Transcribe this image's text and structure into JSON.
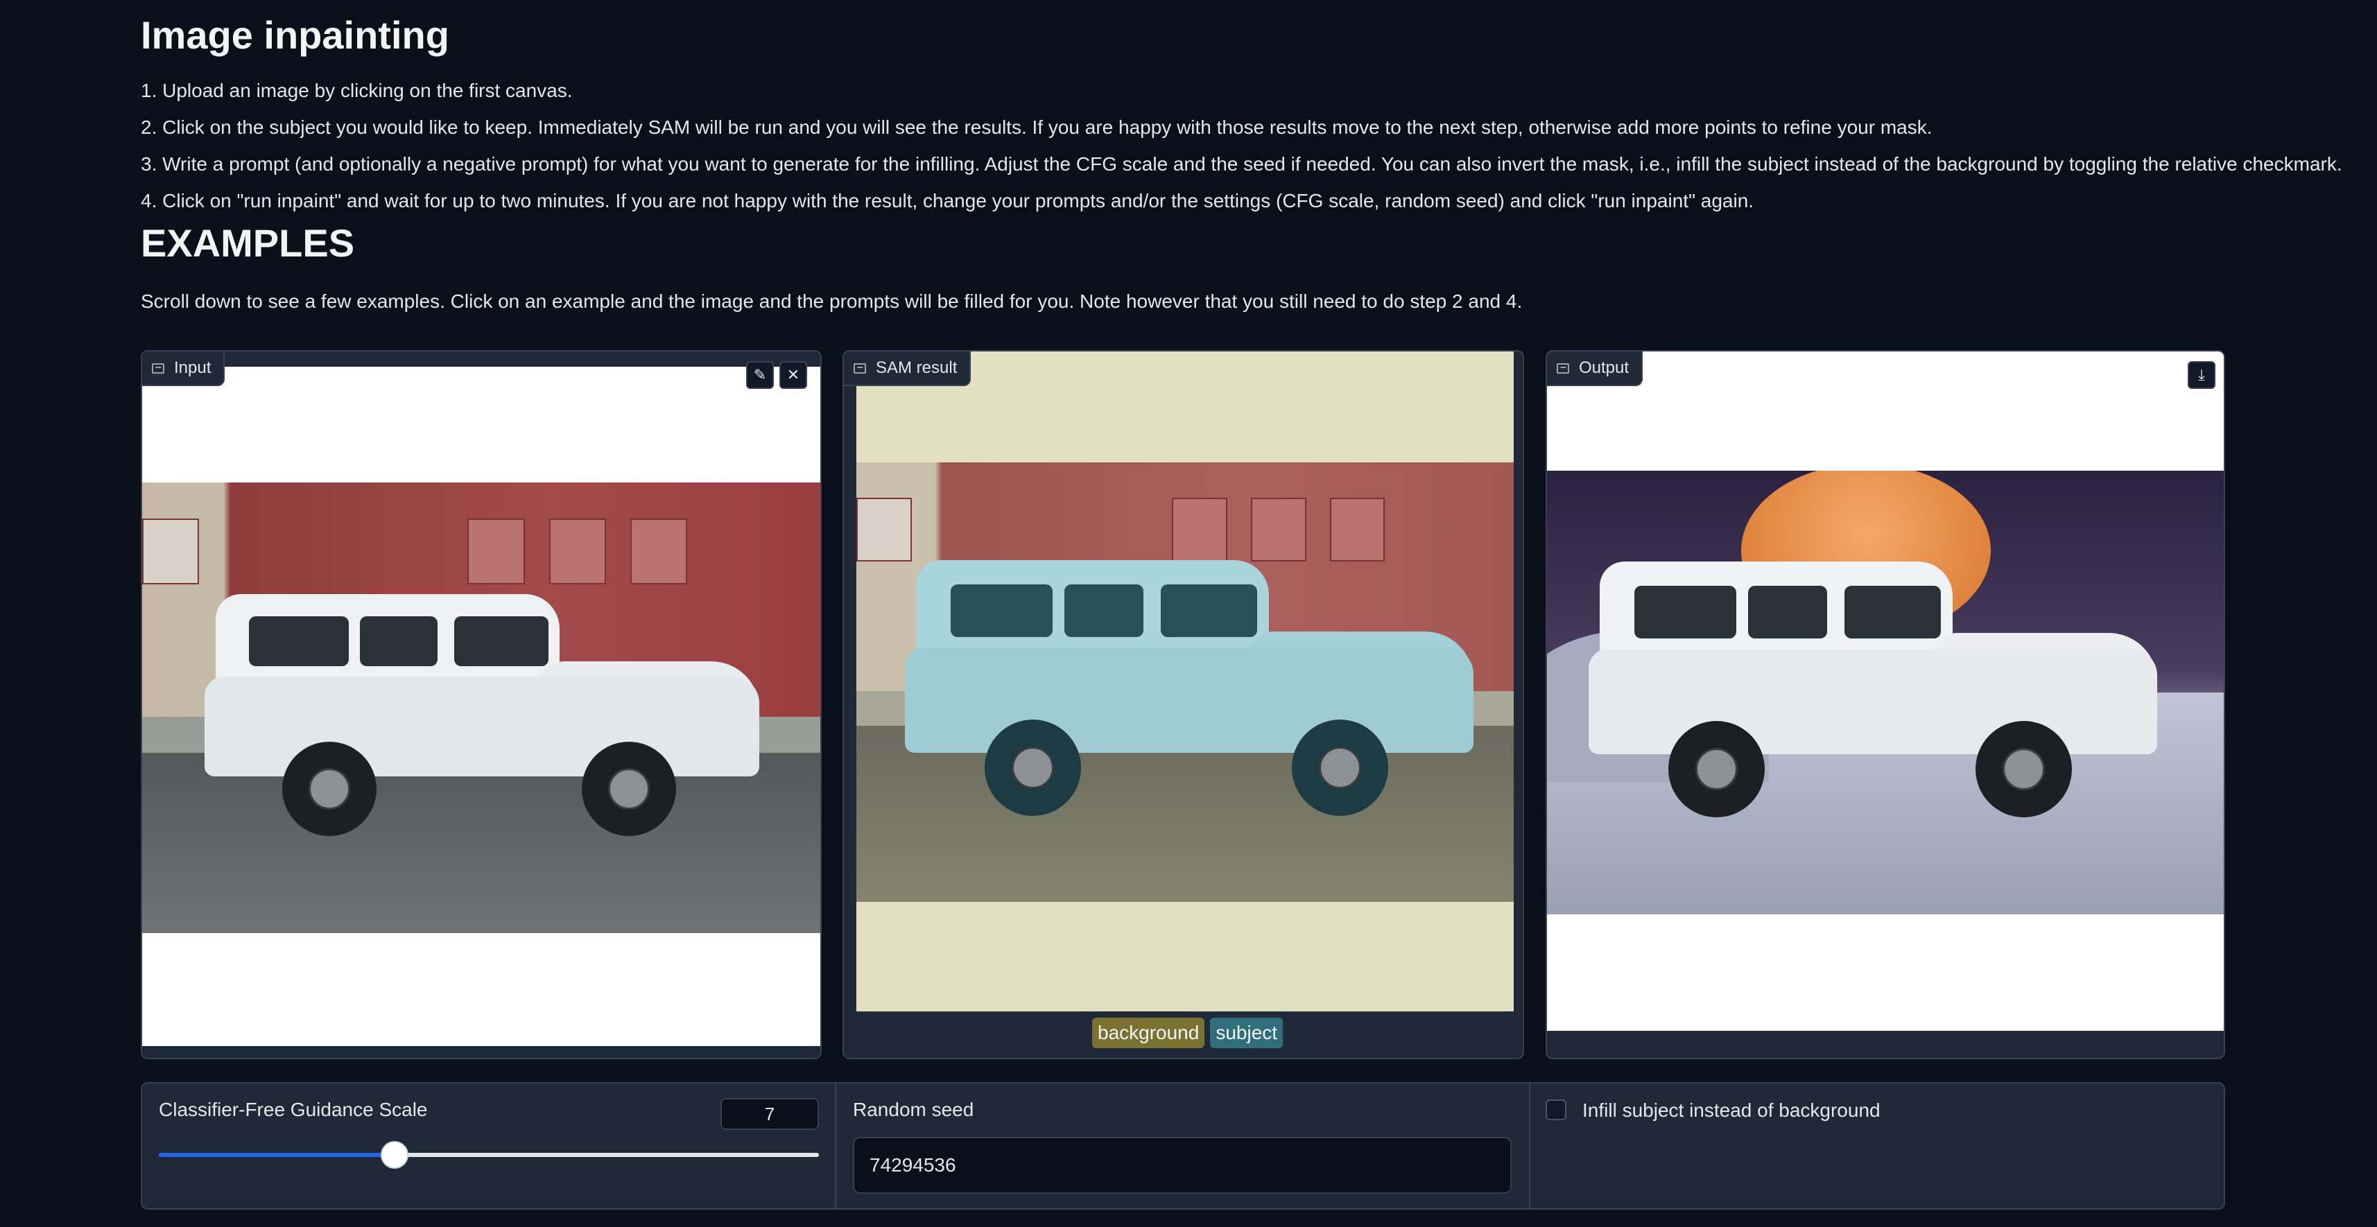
{
  "header": {
    "title": "Image inpainting",
    "steps": [
      "1. Upload an image by clicking on the first canvas.",
      "2. Click on the subject you would like to keep. Immediately SAM will be run and you will see the results. If you are happy with those results move to the next step, otherwise add more points to refine your mask.",
      "3. Write a prompt (and optionally a negative prompt) for what you want to generate for the infilling. Adjust the CFG scale and the seed if needed. You can also invert the mask, i.e., infill the subject instead of the background by toggling the relative checkmark.",
      "4. Click on \"run inpaint\" and wait for up to two minutes. If you are not happy with the result, change your prompts and/or the settings (CFG scale, random seed) and click \"run inpaint\" again."
    ]
  },
  "examples": {
    "heading": "EXAMPLES",
    "note": "Scroll down to see a few examples. Click on an example and the image and the prompts will be filled for you. Note however that you still need to do step 2 and 4."
  },
  "panels": {
    "input": {
      "label": "Input",
      "icon": "image-icon",
      "edit_icon": "pencil-icon",
      "close_icon": "close-icon"
    },
    "sam": {
      "label": "SAM result",
      "icon": "image-icon",
      "legend": [
        {
          "label": "background",
          "color": "#7a7230"
        },
        {
          "label": "subject",
          "color": "#2f6e7a"
        }
      ]
    },
    "output": {
      "label": "Output",
      "icon": "image-icon",
      "download_icon": "download-icon"
    }
  },
  "controls": {
    "cfg": {
      "label": "Classifier-Free Guidance Scale",
      "value": "7",
      "slider_fraction": 0.357
    },
    "seed": {
      "label": "Random seed",
      "value": "74294536"
    },
    "invert": {
      "label": "Infill subject instead of background",
      "checked": false
    }
  },
  "colors": {
    "background": "#0b0f19",
    "panel": "#1f2937",
    "border": "#374151",
    "accent": "#2563eb",
    "sam_overlay": "#e2e0c0"
  }
}
